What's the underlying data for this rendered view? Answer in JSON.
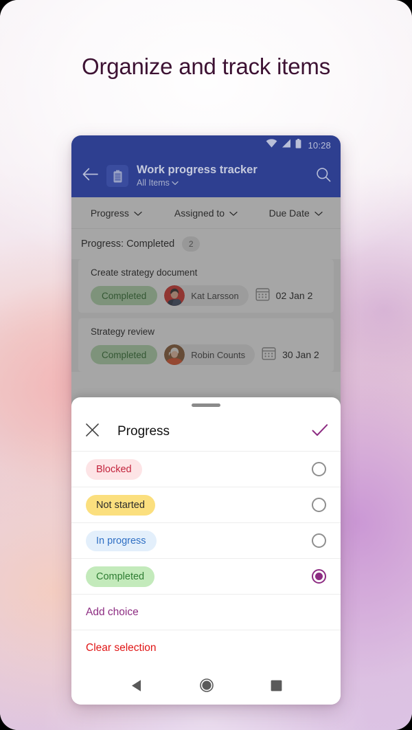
{
  "headline": "Organize and track items",
  "colors": {
    "appbar": "#2e3f90",
    "accent_purple": "#8d2c82",
    "danger_red": "#e01414",
    "scrim": "rgba(60,60,60,0.46)",
    "headline_text": "#3d1233"
  },
  "phone": {
    "statusbar": {
      "time": "10:28",
      "icons": [
        "wifi-icon",
        "cellular-signal-icon",
        "battery-icon"
      ]
    },
    "appbar": {
      "back_icon": "back-arrow-icon",
      "app_icon": "clipboard-icon",
      "title": "Work progress tracker",
      "subtitle": "All Items",
      "subtitle_chevron": "chevron-down-icon",
      "search_icon": "search-icon"
    },
    "filters": [
      {
        "label": "Progress",
        "icon": "chevron-down-icon"
      },
      {
        "label": "Assigned to",
        "icon": "chevron-down-icon"
      },
      {
        "label": "Due Date",
        "icon": "chevron-down-icon"
      }
    ],
    "group": {
      "label": "Progress: Completed",
      "count": "2"
    },
    "tasks": [
      {
        "title": "Create strategy document",
        "status": "Completed",
        "status_bg": "#b6ddb0",
        "status_fg": "#2c6e2c",
        "assignee": "Kat Larsson",
        "avatar": "avatar-kat-larsson",
        "due_icon": "calendar-icon",
        "due": "02 Jan 2"
      },
      {
        "title": "Strategy review",
        "status": "Completed",
        "status_bg": "#b6ddb0",
        "status_fg": "#2c6e2c",
        "assignee": "Robin Counts",
        "avatar": "avatar-robin-counts",
        "due_icon": "calendar-icon",
        "due": "30 Jan 2"
      }
    ],
    "sheet": {
      "close_icon": "close-icon",
      "title": "Progress",
      "confirm_icon": "checkmark-icon",
      "options": [
        {
          "label": "Blocked",
          "bg": "#fde4e6",
          "fg": "#c2233c",
          "selected": false
        },
        {
          "label": "Not started",
          "bg": "#fbdf7e",
          "fg": "#2b2b2b",
          "selected": false
        },
        {
          "label": "In progress",
          "bg": "#e3effb",
          "fg": "#2f6fc4",
          "selected": false
        },
        {
          "label": "Completed",
          "bg": "#c3eabb",
          "fg": "#2e7d32",
          "selected": true
        }
      ],
      "add_choice": "Add choice",
      "clear_selection": "Clear selection"
    },
    "navbar": {
      "back": "nav-back-icon",
      "home": "nav-home-icon",
      "recents": "nav-recents-icon"
    }
  }
}
